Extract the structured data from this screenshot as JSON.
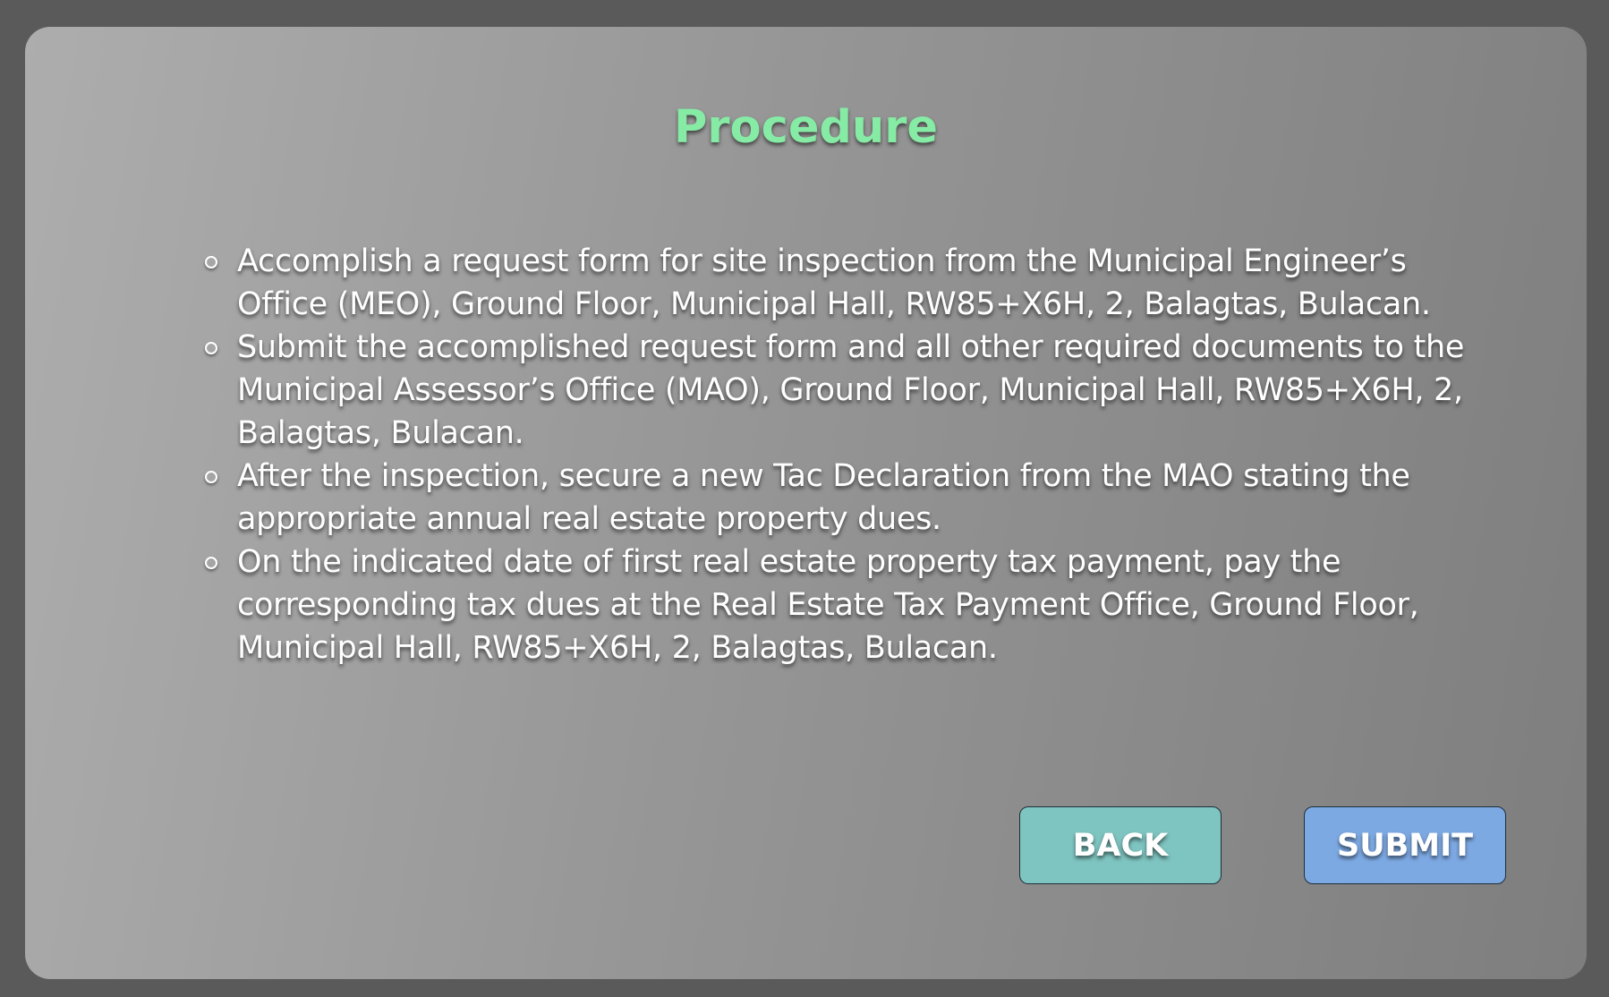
{
  "page": {
    "title": "Procedure",
    "title_color": "#86eba4"
  },
  "steps": [
    "Accomplish a request form for site inspection from the Municipal Engineer’s Office (MEO), Ground Floor, Municipal Hall, RW85+X6H, 2, Balagtas, Bulacan.",
    "Submit the accomplished request form and all other required documents to the Municipal Assessor’s Office (MAO), Ground Floor, Municipal Hall, RW85+X6H, 2, Balagtas, Bulacan.",
    "After the inspection, secure a new Tac Declaration from the MAO stating the appropriate annual real estate property dues.",
    "On the indicated date of first real estate property tax payment, pay the corresponding tax dues at the Real Estate Tax Payment Office, Ground Floor, Municipal Hall, RW85+X6H, 2, Balagtas, Bulacan."
  ],
  "actions": {
    "back_label": "BACK",
    "back_color": "#7ec4c0",
    "submit_label": "SUBMIT",
    "submit_color": "#7da9e3"
  }
}
